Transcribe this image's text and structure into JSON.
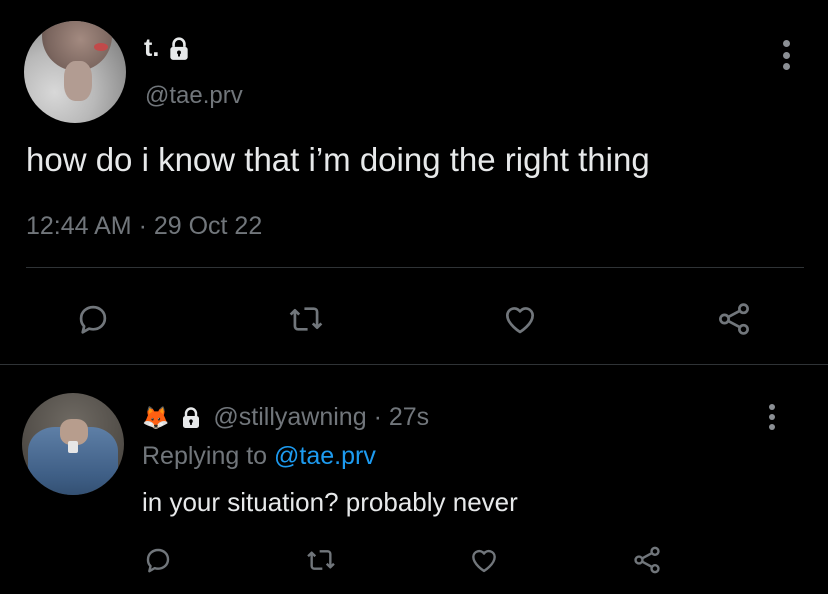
{
  "tweet": {
    "display_name": "t.",
    "handle": "@tae.prv",
    "text": "how do i know that i’m doing the right thing",
    "timestamp": "12:44 AM · 29 Oct 22",
    "locked": true
  },
  "reply": {
    "display_name_emoji": "🦊",
    "handle_time": "@stillyawning · 27s",
    "replying_prefix": "Replying to",
    "replying_mention": "@tae.prv",
    "text": "in your situation? probably never",
    "locked": true
  },
  "icons": [
    "reply-icon",
    "retweet-icon",
    "like-icon",
    "share-icon",
    "lock-icon",
    "more-icon"
  ],
  "colors": {
    "background": "#000000",
    "text": "#e7e9ea",
    "muted": "#71767b",
    "link": "#1d9bf0",
    "divider": "#2f3336"
  }
}
